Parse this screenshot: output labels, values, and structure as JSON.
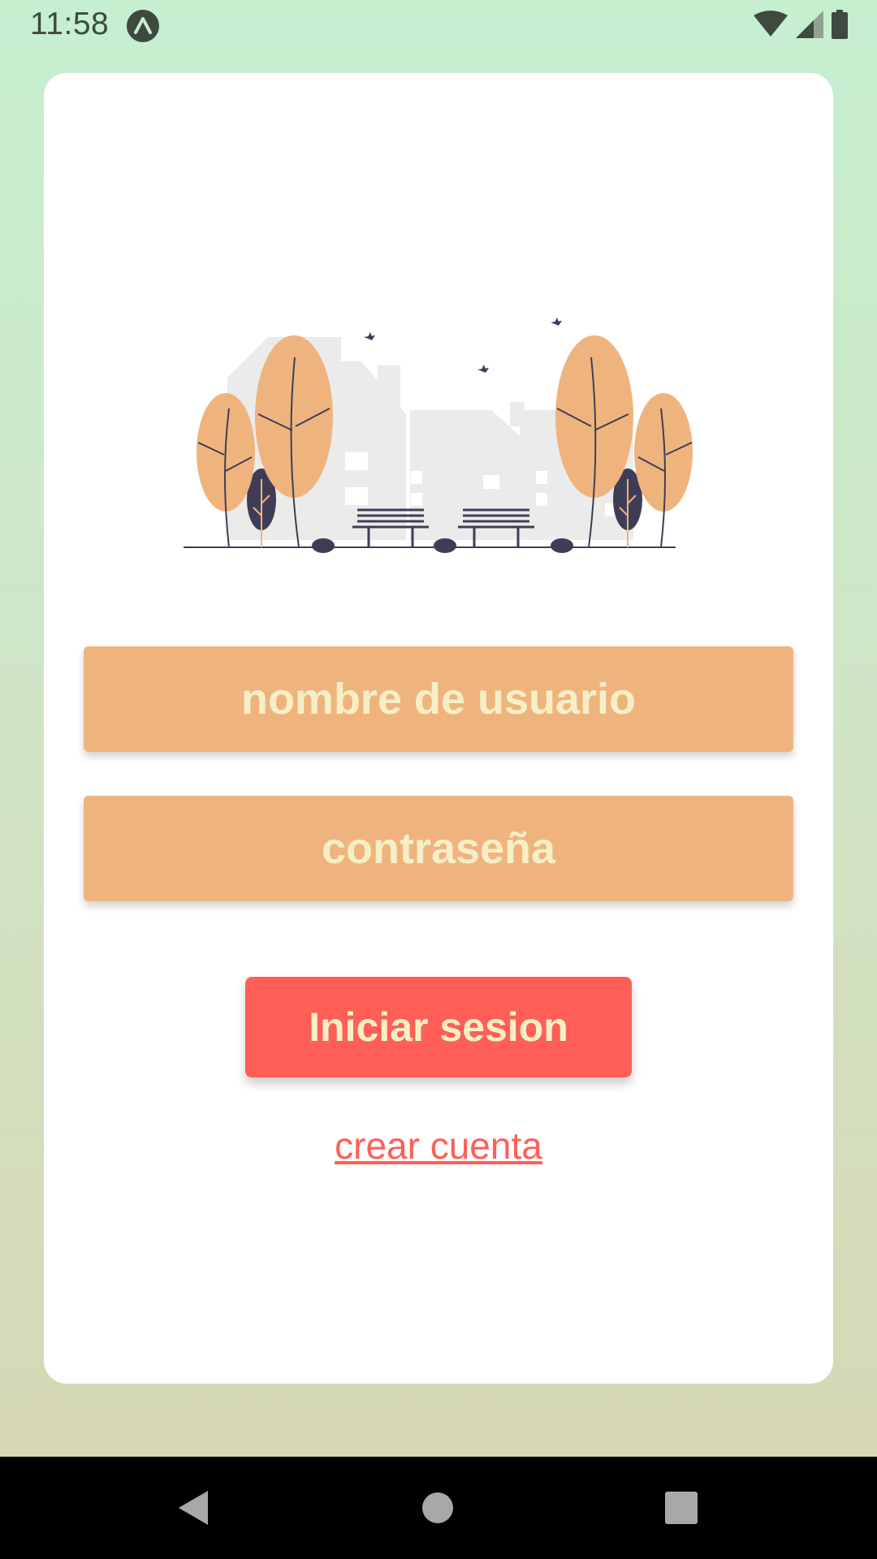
{
  "status_bar": {
    "time": "11:58",
    "app_icon": "expo-icon",
    "icons": [
      "wifi-icon",
      "cellular-signal-icon",
      "battery-icon"
    ]
  },
  "login": {
    "username_placeholder": "nombre de usuario",
    "password_placeholder": "contraseña",
    "login_button": "Iniciar sesion",
    "create_account_link": "crear cuenta"
  },
  "nav_bar": {
    "icons": [
      "back-icon",
      "home-icon",
      "recents-icon"
    ]
  },
  "colors": {
    "background_top": "#c6efd0",
    "background_bottom": "#d7d6b3",
    "card": "#ffffff",
    "input": "#efb47e",
    "input_text": "#f6efc6",
    "button": "#ff5f57",
    "link": "#ff5f57"
  }
}
